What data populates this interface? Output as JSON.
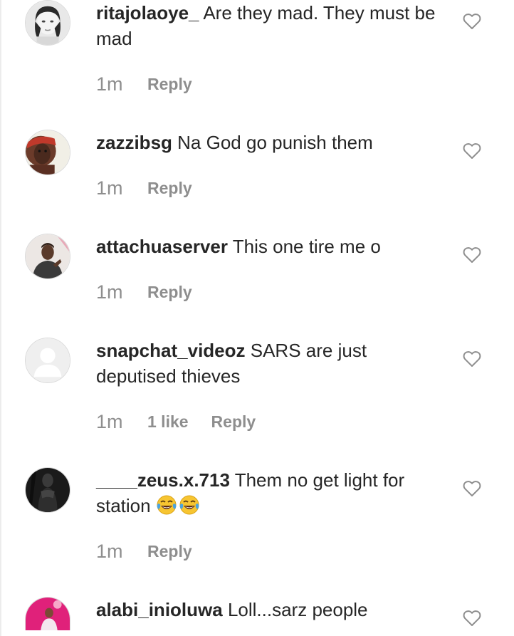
{
  "comments": [
    {
      "username": "ritajolaoye_",
      "text": "Are they mad. They must be mad",
      "time": "1m",
      "likes": "",
      "reply_label": "Reply",
      "avatar": "user-avatar-photo"
    },
    {
      "username": "zazzibsg",
      "text": "Na God go punish them",
      "time": "1m",
      "likes": "",
      "reply_label": "Reply",
      "avatar": "user-avatar-photo"
    },
    {
      "username": "attachuaserver",
      "text": "This one tire me o",
      "time": "1m",
      "likes": "",
      "reply_label": "Reply",
      "avatar": "user-avatar-photo"
    },
    {
      "username": "snapchat_videoz",
      "text": "SARS are just deputised thieves",
      "time": "1m",
      "likes": "1 like",
      "reply_label": "Reply",
      "avatar": "default-avatar-placeholder"
    },
    {
      "username": "____zeus.x.713",
      "text": "Them no get light for station",
      "emoji": "face-with-tears-of-joy x2",
      "time": "1m",
      "likes": "",
      "reply_label": "Reply",
      "avatar": "user-avatar-photo"
    },
    {
      "username": "alabi_inioluwa",
      "text": "Loll...sarz people",
      "time": "",
      "likes": "",
      "reply_label": "",
      "avatar": "user-avatar-photo"
    }
  ],
  "icons": {
    "like": "heart-outline-icon"
  },
  "colors": {
    "text": "#262626",
    "meta": "#8e8e8e",
    "icon": "#8e8e8e"
  }
}
